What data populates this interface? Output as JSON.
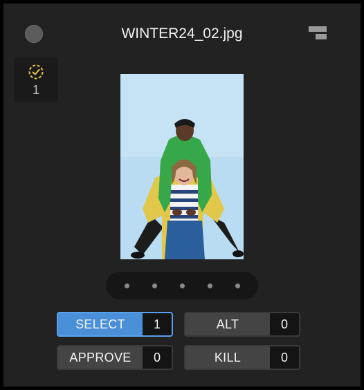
{
  "header": {
    "title": "WINTER24_02.jpg"
  },
  "selection_badge": {
    "count": "1",
    "icon": "dashed-check-circle-icon",
    "color": "#e8c44a"
  },
  "image": {
    "subject": "photo-two-women-piggyback",
    "background_color": "#b9dcf2"
  },
  "pager": {
    "dot_count": 5
  },
  "buttons": {
    "select": {
      "label": "SELECT",
      "count": "1",
      "active": true
    },
    "alt": {
      "label": "ALT",
      "count": "0",
      "active": false
    },
    "approve": {
      "label": "APPROVE",
      "count": "0",
      "active": false
    },
    "kill": {
      "label": "KILL",
      "count": "0",
      "active": false
    }
  },
  "colors": {
    "accent": "#4a90d9",
    "panel": "#222222",
    "button": "#444444"
  }
}
